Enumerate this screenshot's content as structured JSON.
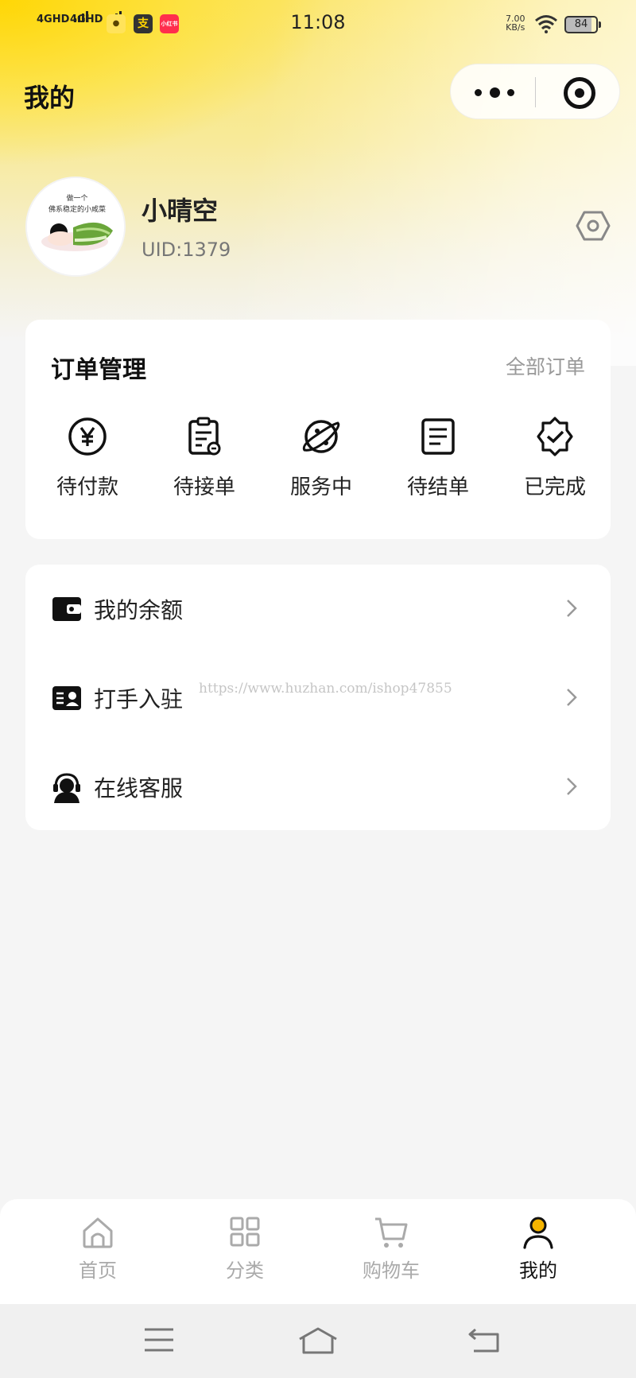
{
  "status_bar": {
    "signal_1": "4GHD",
    "signal_2": "4GHD",
    "app_icon_1": "apple-app-icon",
    "app_icon_2": "支",
    "app_icon_3": "小红书",
    "time": "11:08",
    "net_speed_value": "7.00",
    "net_speed_unit": "KB/s",
    "wifi_icon": "wifi-icon",
    "battery": "84"
  },
  "header": {
    "title": "我的",
    "capsule_more_icon": "more-dots-icon",
    "capsule_close_icon": "target-circle-icon"
  },
  "profile": {
    "avatar_icon": "avatar-image",
    "username": "小晴空",
    "uid": "UID:1379",
    "settings_icon": "hexagon-settings-icon"
  },
  "orders": {
    "title": "订单管理",
    "all_orders": "全部订单",
    "items": [
      {
        "label": "待付款",
        "icon": "yen-coin-icon"
      },
      {
        "label": "待接单",
        "icon": "clipboard-icon"
      },
      {
        "label": "服务中",
        "icon": "planet-icon"
      },
      {
        "label": "待结单",
        "icon": "document-lines-icon"
      },
      {
        "label": "已完成",
        "icon": "badge-check-icon"
      }
    ]
  },
  "menu": [
    {
      "label": "我的余额",
      "icon": "wallet-icon"
    },
    {
      "label": "打手入驻",
      "icon": "id-card-icon"
    },
    {
      "label": "在线客服",
      "icon": "headset-agent-icon"
    }
  ],
  "watermark": "https://www.huzhan.com/ishop47855",
  "tab_bar": [
    {
      "label": "首页",
      "icon": "home-icon",
      "active": false
    },
    {
      "label": "分类",
      "icon": "grid-icon",
      "active": false
    },
    {
      "label": "购物车",
      "icon": "cart-icon",
      "active": false
    },
    {
      "label": "我的",
      "icon": "person-icon",
      "active": true
    }
  ],
  "colors": {
    "accent_yellow": "#ffd400",
    "active_dot": "#f5b400",
    "inactive_tab": "#aaaaaa"
  },
  "system_nav": {
    "menu_icon": "menu-lines-icon",
    "home_icon": "system-home-icon",
    "back_icon": "back-arrow-icon"
  }
}
